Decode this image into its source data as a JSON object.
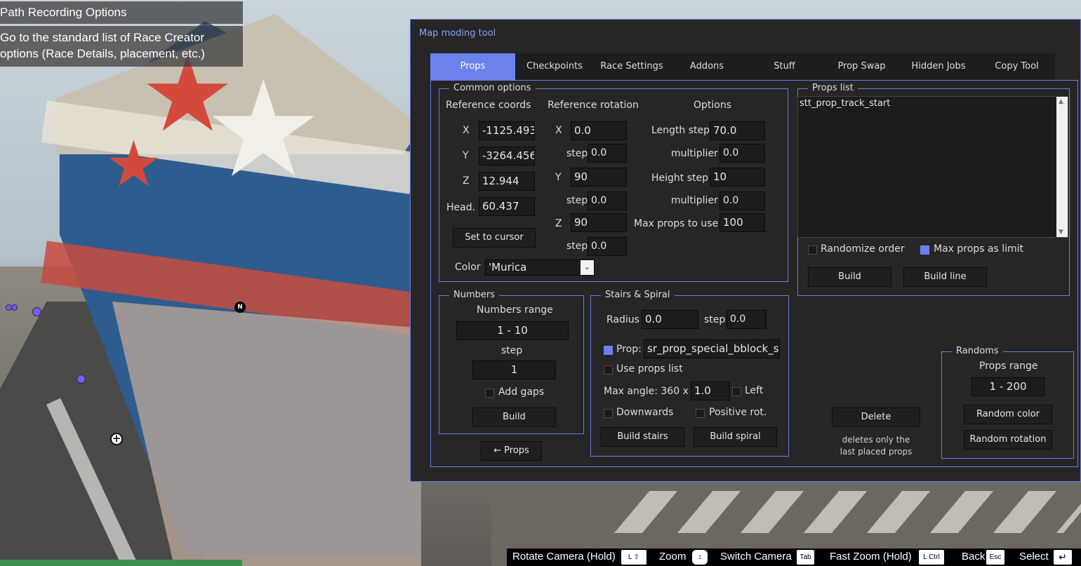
{
  "race_creator": {
    "title": "Path Recording Options",
    "description_line1": "Go to the standard list of Race Creator",
    "description_line2": "options (Race Details, placement, etc.)"
  },
  "map_markers": {
    "north_label": "N"
  },
  "window": {
    "title": "Map moding tool",
    "accent_color": "#6b82ec",
    "tabs": [
      "Props",
      "Checkpoints",
      "Race Settings",
      "Addons",
      "Stuff",
      "Prop Swap",
      "Hidden Jobs",
      "Copy Tool"
    ],
    "active_tab": "Props"
  },
  "common": {
    "legend": "Common options",
    "coords_header": "Reference coords",
    "rotation_header": "Reference rotation",
    "options_header": "Options",
    "x_label": "X",
    "y_label": "Y",
    "z_label": "Z",
    "head_label": "Head.",
    "x_value": "-1125.493",
    "y_value": "-3264.456",
    "z_value": "12.944",
    "head_value": "60.437",
    "set_cursor": "Set to cursor",
    "rot_x": "0.0",
    "rot_x_step": "0.0",
    "rot_y": "90",
    "rot_y_step": "0.0",
    "rot_z": "90",
    "rot_z_step": "0.0",
    "step_label": "step",
    "length_step_label": "Length step",
    "length_step": "70.0",
    "multiplier_label": "multiplier",
    "length_multiplier": "0.0",
    "height_step_label": "Height step",
    "height_step": "10",
    "height_multiplier": "0.0",
    "max_props_label": "Max props to use",
    "max_props": "100",
    "color_label": "Color",
    "color_value": "'Murica"
  },
  "props_list": {
    "legend": "Props list",
    "items": [
      "stt_prop_track_start"
    ],
    "randomize_label": "Randomize order",
    "randomize_checked": false,
    "max_limit_label": "Max props as limit",
    "max_limit_checked": true,
    "build": "Build",
    "build_line": "Build line"
  },
  "numbers": {
    "legend": "Numbers",
    "range_label": "Numbers range",
    "range_value": "1 - 10",
    "step_label": "step",
    "step_value": "1",
    "add_gaps_label": "Add gaps",
    "add_gaps_checked": false,
    "build": "Build"
  },
  "back_button": "← Props",
  "stairs": {
    "legend": "Stairs & Spiral",
    "radius_label": "Radius",
    "radius_value": "0.0",
    "step_label": "step",
    "step_value": "0.0",
    "prop_label": "Prop:",
    "prop_checked": true,
    "prop_value": "sr_prop_special_bblock_sr",
    "use_list_label": "Use props list",
    "use_list_checked": false,
    "max_angle_label": "Max angle: 360 x",
    "max_angle_value": "1.0",
    "left_label": "Left",
    "left_checked": false,
    "downwards_label": "Downwards",
    "downwards_checked": false,
    "positive_label": "Positive rot.",
    "positive_checked": false,
    "build_stairs": "Build stairs",
    "build_spiral": "Build spiral"
  },
  "delete": {
    "button": "Delete",
    "note_line1": "deletes only the",
    "note_line2": "last placed props"
  },
  "randoms": {
    "legend": "Randoms",
    "range_label": "Props range",
    "range_value": "1 - 200",
    "random_color": "Random color",
    "random_rotation": "Random rotation"
  },
  "hints": [
    {
      "label": "Rotate Camera (Hold)",
      "key": "L ⇧"
    },
    {
      "label": "Zoom",
      "key": ""
    },
    {
      "label": "Switch Camera",
      "key": "Tab"
    },
    {
      "label": "Fast Zoom (Hold)",
      "key": "L Ctrl"
    },
    {
      "label": "Back",
      "key": "Esc"
    },
    {
      "label": "Select",
      "key": "↵"
    }
  ]
}
